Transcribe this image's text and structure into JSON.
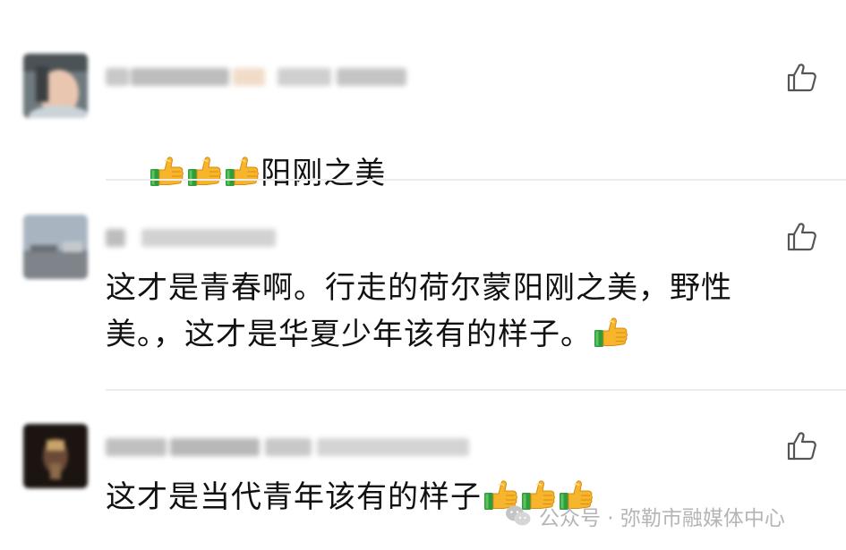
{
  "comments": [
    {
      "name": "",
      "text": "阳刚之美",
      "leading_emoji": [
        "thumbs-up-icon",
        "thumbs-up-icon",
        "thumbs-up-icon"
      ],
      "trailing_emoji": []
    },
    {
      "name": "",
      "text": "这才是青春啊。行走的荷尔蒙阳刚之美，野性美。，这才是华夏少年该有的样子。",
      "leading_emoji": [],
      "trailing_emoji": [
        "thumbs-up-icon"
      ]
    },
    {
      "name": "",
      "text": "这才是当代青年该有的样子",
      "leading_emoji": [],
      "trailing_emoji": [
        "thumbs-up-icon",
        "thumbs-up-icon",
        "thumbs-up-icon"
      ]
    }
  ],
  "like_icon": "like-outline-icon",
  "watermark": {
    "label": "公众号 · 弥勒市融媒体中心",
    "icon": "wechat-logo-icon"
  },
  "colors": {
    "text": "#111111",
    "icon": "#555555",
    "divider": "#ececec",
    "watermark": "#b5b5b5",
    "emoji_hand": "#f7b52b",
    "emoji_cuff": "#2f9e3a"
  }
}
